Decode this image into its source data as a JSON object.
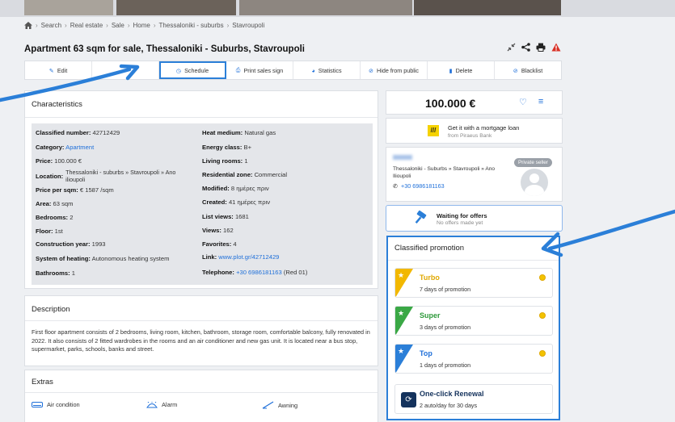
{
  "breadcrumb": [
    "Search",
    "Real estate",
    "Sale",
    "Home",
    "Thessaloniki - suburbs",
    "Stavroupoli"
  ],
  "title": "Apartment 63 sqm for sale, Thessaloniki - Suburbs, Stavroupoli",
  "actions": {
    "edit": "Edit",
    "schedule": "Schedule",
    "print": "Print sales sign",
    "statistics": "Statistics",
    "hide": "Hide from public",
    "delete": "Delete",
    "blacklist": "Blacklist"
  },
  "characteristics": {
    "title": "Characteristics",
    "classified_number": {
      "label": "Classified number:",
      "value": "42712429"
    },
    "category": {
      "label": "Category:",
      "value": "Apartment"
    },
    "price": {
      "label": "Price:",
      "value": "100.000 €"
    },
    "location": {
      "label": "Location:",
      "value_line1": "Thessaloniki - suburbs » Stavroupoli » Ano",
      "value_line2": "ilioupoli"
    },
    "price_per_sqm": {
      "label": "Price per sqm:",
      "value": "€ 1587 /sqm"
    },
    "area": {
      "label": "Area:",
      "value": "63 sqm"
    },
    "bedrooms": {
      "label": "Bedrooms:",
      "value": "2"
    },
    "floor": {
      "label": "Floor:",
      "value": "1st"
    },
    "construction_year": {
      "label": "Construction year:",
      "value": "1993"
    },
    "heating_system": {
      "label": "System of heating:",
      "value": "Autonomous heating system"
    },
    "bathrooms": {
      "label": "Bathrooms:",
      "value": "1"
    },
    "heat_medium": {
      "label": "Heat medium:",
      "value": "Natural gas"
    },
    "energy_class": {
      "label": "Energy class:",
      "value": "B+"
    },
    "living_rooms": {
      "label": "Living rooms:",
      "value": "1"
    },
    "residential_zone": {
      "label": "Residential zone:",
      "value": "Commercial"
    },
    "modified": {
      "label": "Modified:",
      "value": "8 ημέρες πριν"
    },
    "created": {
      "label": "Created:",
      "value": "41 ημέρες πριν"
    },
    "list_views": {
      "label": "List views:",
      "value": "1681"
    },
    "views": {
      "label": "Views:",
      "value": "162"
    },
    "favorites": {
      "label": "Favorites:",
      "value": "4"
    },
    "link": {
      "label": "Link:",
      "value": "www.plot.gr/42712429"
    },
    "telephone": {
      "label": "Telephone:",
      "value": "+30 6986181163",
      "extra": "(Red 01)"
    }
  },
  "description": {
    "title": "Description",
    "text": "First floor apartment consists of 2 bedrooms, living room, kitchen, bathroom, storage room, comfortable balcony, fully renovated in 2022. It also consists of 2 fitted wardrobes in the rooms and an air conditioner and new gas unit. It is located near a bus stop, supermarket, parks, schools, banks and street."
  },
  "extras": {
    "title": "Extras",
    "items": [
      "Air condition",
      "Alarm",
      "Awning"
    ]
  },
  "price_box": {
    "price": "100.000 €"
  },
  "mortgage": {
    "logo": "///",
    "title": "Get it with a mortgage loan",
    "subtitle": "from Piraeus Bank"
  },
  "seller": {
    "badge": "Private seller",
    "location": "Thessaloniki - Suburbs » Stavroupoli » Ano Ilioupoli",
    "phone": "+30 6986181163"
  },
  "offers": {
    "title": "Waiting for offers",
    "subtitle": "No offers made yet"
  },
  "promotion": {
    "title": "Classified promotion",
    "items": [
      {
        "name": "Turbo",
        "days": "7 days of promotion",
        "color": "#f2b800"
      },
      {
        "name": "Super",
        "days": "3 days of promotion",
        "color": "#3aa845"
      },
      {
        "name": "Top",
        "days": "1 days of promotion",
        "color": "#2b7fd8"
      },
      {
        "name": "One-click Renewal",
        "days": "2 auto/day for 30 days",
        "color": "#14325c"
      }
    ]
  },
  "colors": {
    "accent": "#1e6fd9",
    "highlight": "#2b7fd8",
    "danger": "#d93025"
  }
}
